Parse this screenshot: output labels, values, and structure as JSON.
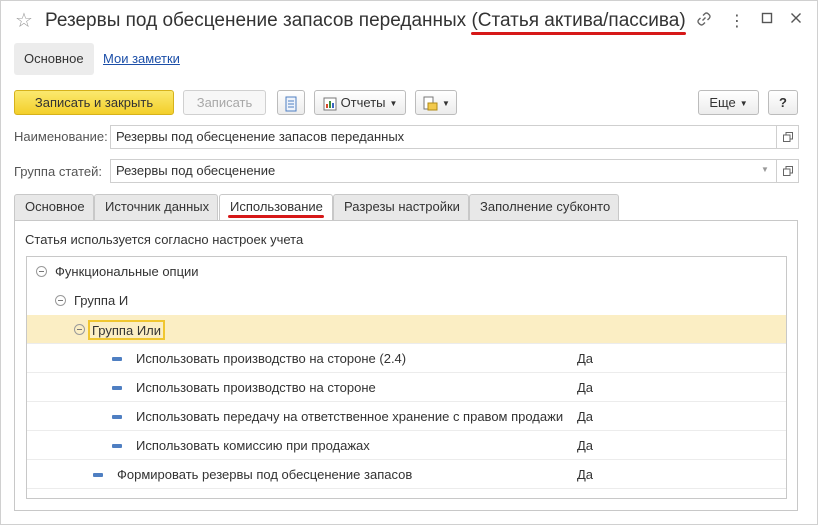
{
  "window": {
    "title_main": "Резервы под обесценение запасов переданных ",
    "title_accent": "(Статья актива/пассива)"
  },
  "nav": {
    "main_tab": "Основное",
    "notes_link": "Мои заметки"
  },
  "toolbar": {
    "save_close": "Записать и закрыть",
    "save": "Записать",
    "reports": "Отчеты",
    "more": "Еще",
    "help": "?"
  },
  "form": {
    "name_label": "Наименование:",
    "name_value": "Резервы под обесценение запасов переданных",
    "group_label": "Группа статей:",
    "group_value": "Резервы под обесценение"
  },
  "tabs": [
    {
      "label": "Основное"
    },
    {
      "label": "Источник данных"
    },
    {
      "label": "Использование"
    },
    {
      "label": "Разрезы настройки"
    },
    {
      "label": "Заполнение субконто"
    }
  ],
  "usage": {
    "caption": "Статья используется согласно настроек учета",
    "tree": [
      {
        "label": "Функциональные опции",
        "value": ""
      },
      {
        "label": "Группа И",
        "value": ""
      },
      {
        "label": "Группа Или",
        "value": ""
      },
      {
        "label": "Использовать производство на стороне (2.4)",
        "value": "Да"
      },
      {
        "label": "Использовать производство на стороне",
        "value": "Да"
      },
      {
        "label": "Использовать передачу на ответственное хранение с правом продажи",
        "value": "Да"
      },
      {
        "label": "Использовать комиссию при продажах",
        "value": "Да"
      },
      {
        "label": "Формировать резервы под обесценение запасов",
        "value": "Да"
      }
    ]
  },
  "colors": {
    "accent_red": "#d61818",
    "primary_button": "#f3cf2a",
    "selection": "#fbeec4",
    "link": "#1c4fa8"
  }
}
